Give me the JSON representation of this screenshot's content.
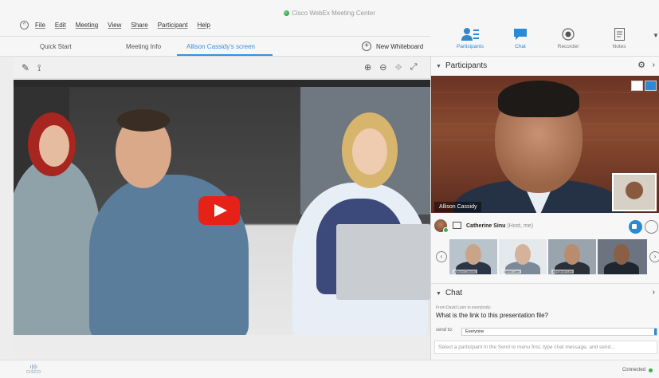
{
  "app": {
    "title": "Cisco WebEx Meeting Center",
    "menu": [
      "File",
      "Edit",
      "Meeting",
      "View",
      "Share",
      "Participant",
      "Help"
    ]
  },
  "tabs": [
    {
      "label": "Quick Start"
    },
    {
      "label": "Meeting Info"
    },
    {
      "label": "Allison Cassidy's screen",
      "active": true
    }
  ],
  "new_whiteboard_label": "New Whiteboard",
  "panel_buttons": [
    {
      "label": "Participants",
      "icon": "participants-icon",
      "active": true
    },
    {
      "label": "Chat",
      "icon": "chat-icon",
      "active": true
    },
    {
      "label": "Recorder",
      "icon": "recorder-icon"
    },
    {
      "label": "Notes",
      "icon": "notes-icon"
    }
  ],
  "participants": {
    "header": "Participants",
    "active_speaker": "Allison Cassidy",
    "host_name": "Catherine Sinu",
    "host_role": "(Host, me)",
    "thumbnails": [
      {
        "name": "Allison Cassidy"
      },
      {
        "name": "David Liam"
      },
      {
        "name": "Benjamin Lee"
      }
    ]
  },
  "chat": {
    "header": "Chat",
    "from_line": "From David Liam to everybody:",
    "message": "What is the link to this presentation file?",
    "send_to_label": "send to:",
    "send_to_value": "Everyone",
    "input_placeholder": "Select a participant in the Send to menu first, type chat message, and send..."
  },
  "status": {
    "logo_text": "CISCO",
    "connection": "Connected"
  },
  "colors": {
    "accent": "#2a8ad6",
    "connected": "#3fae49",
    "play_button": "#e62117"
  }
}
